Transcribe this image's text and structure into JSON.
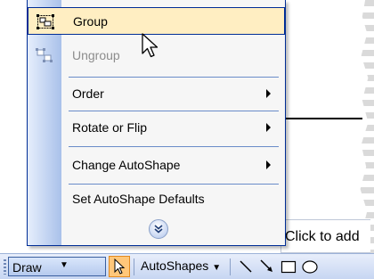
{
  "menu": {
    "items": [
      {
        "label": "Group",
        "state": "highlighted",
        "icon": "group-icon"
      },
      {
        "label": "Ungroup",
        "state": "disabled",
        "icon": "ungroup-icon"
      },
      {
        "label": "Order",
        "submenu": true
      },
      {
        "label": "Rotate or Flip",
        "submenu": true
      },
      {
        "label": "Change AutoShape",
        "submenu": true
      },
      {
        "label": "Set AutoShape Defaults"
      }
    ],
    "expand_icon": "double-chevron-down-icon"
  },
  "placeholder_text": "Click to add",
  "toolbar": {
    "draw_label": "Draw",
    "autoshapes_label": "AutoShapes",
    "tools": [
      "select-pointer-icon",
      "line-icon",
      "arrow-icon",
      "rectangle-icon",
      "oval-icon"
    ]
  },
  "colors": {
    "highlight_bg": "#ffeec2",
    "menu_border": "#002d96",
    "toolbar_gradient_top": "#e8eefb",
    "toolbar_gradient_bottom": "#c7d6f2",
    "pointer_active": "#ffc77a"
  }
}
